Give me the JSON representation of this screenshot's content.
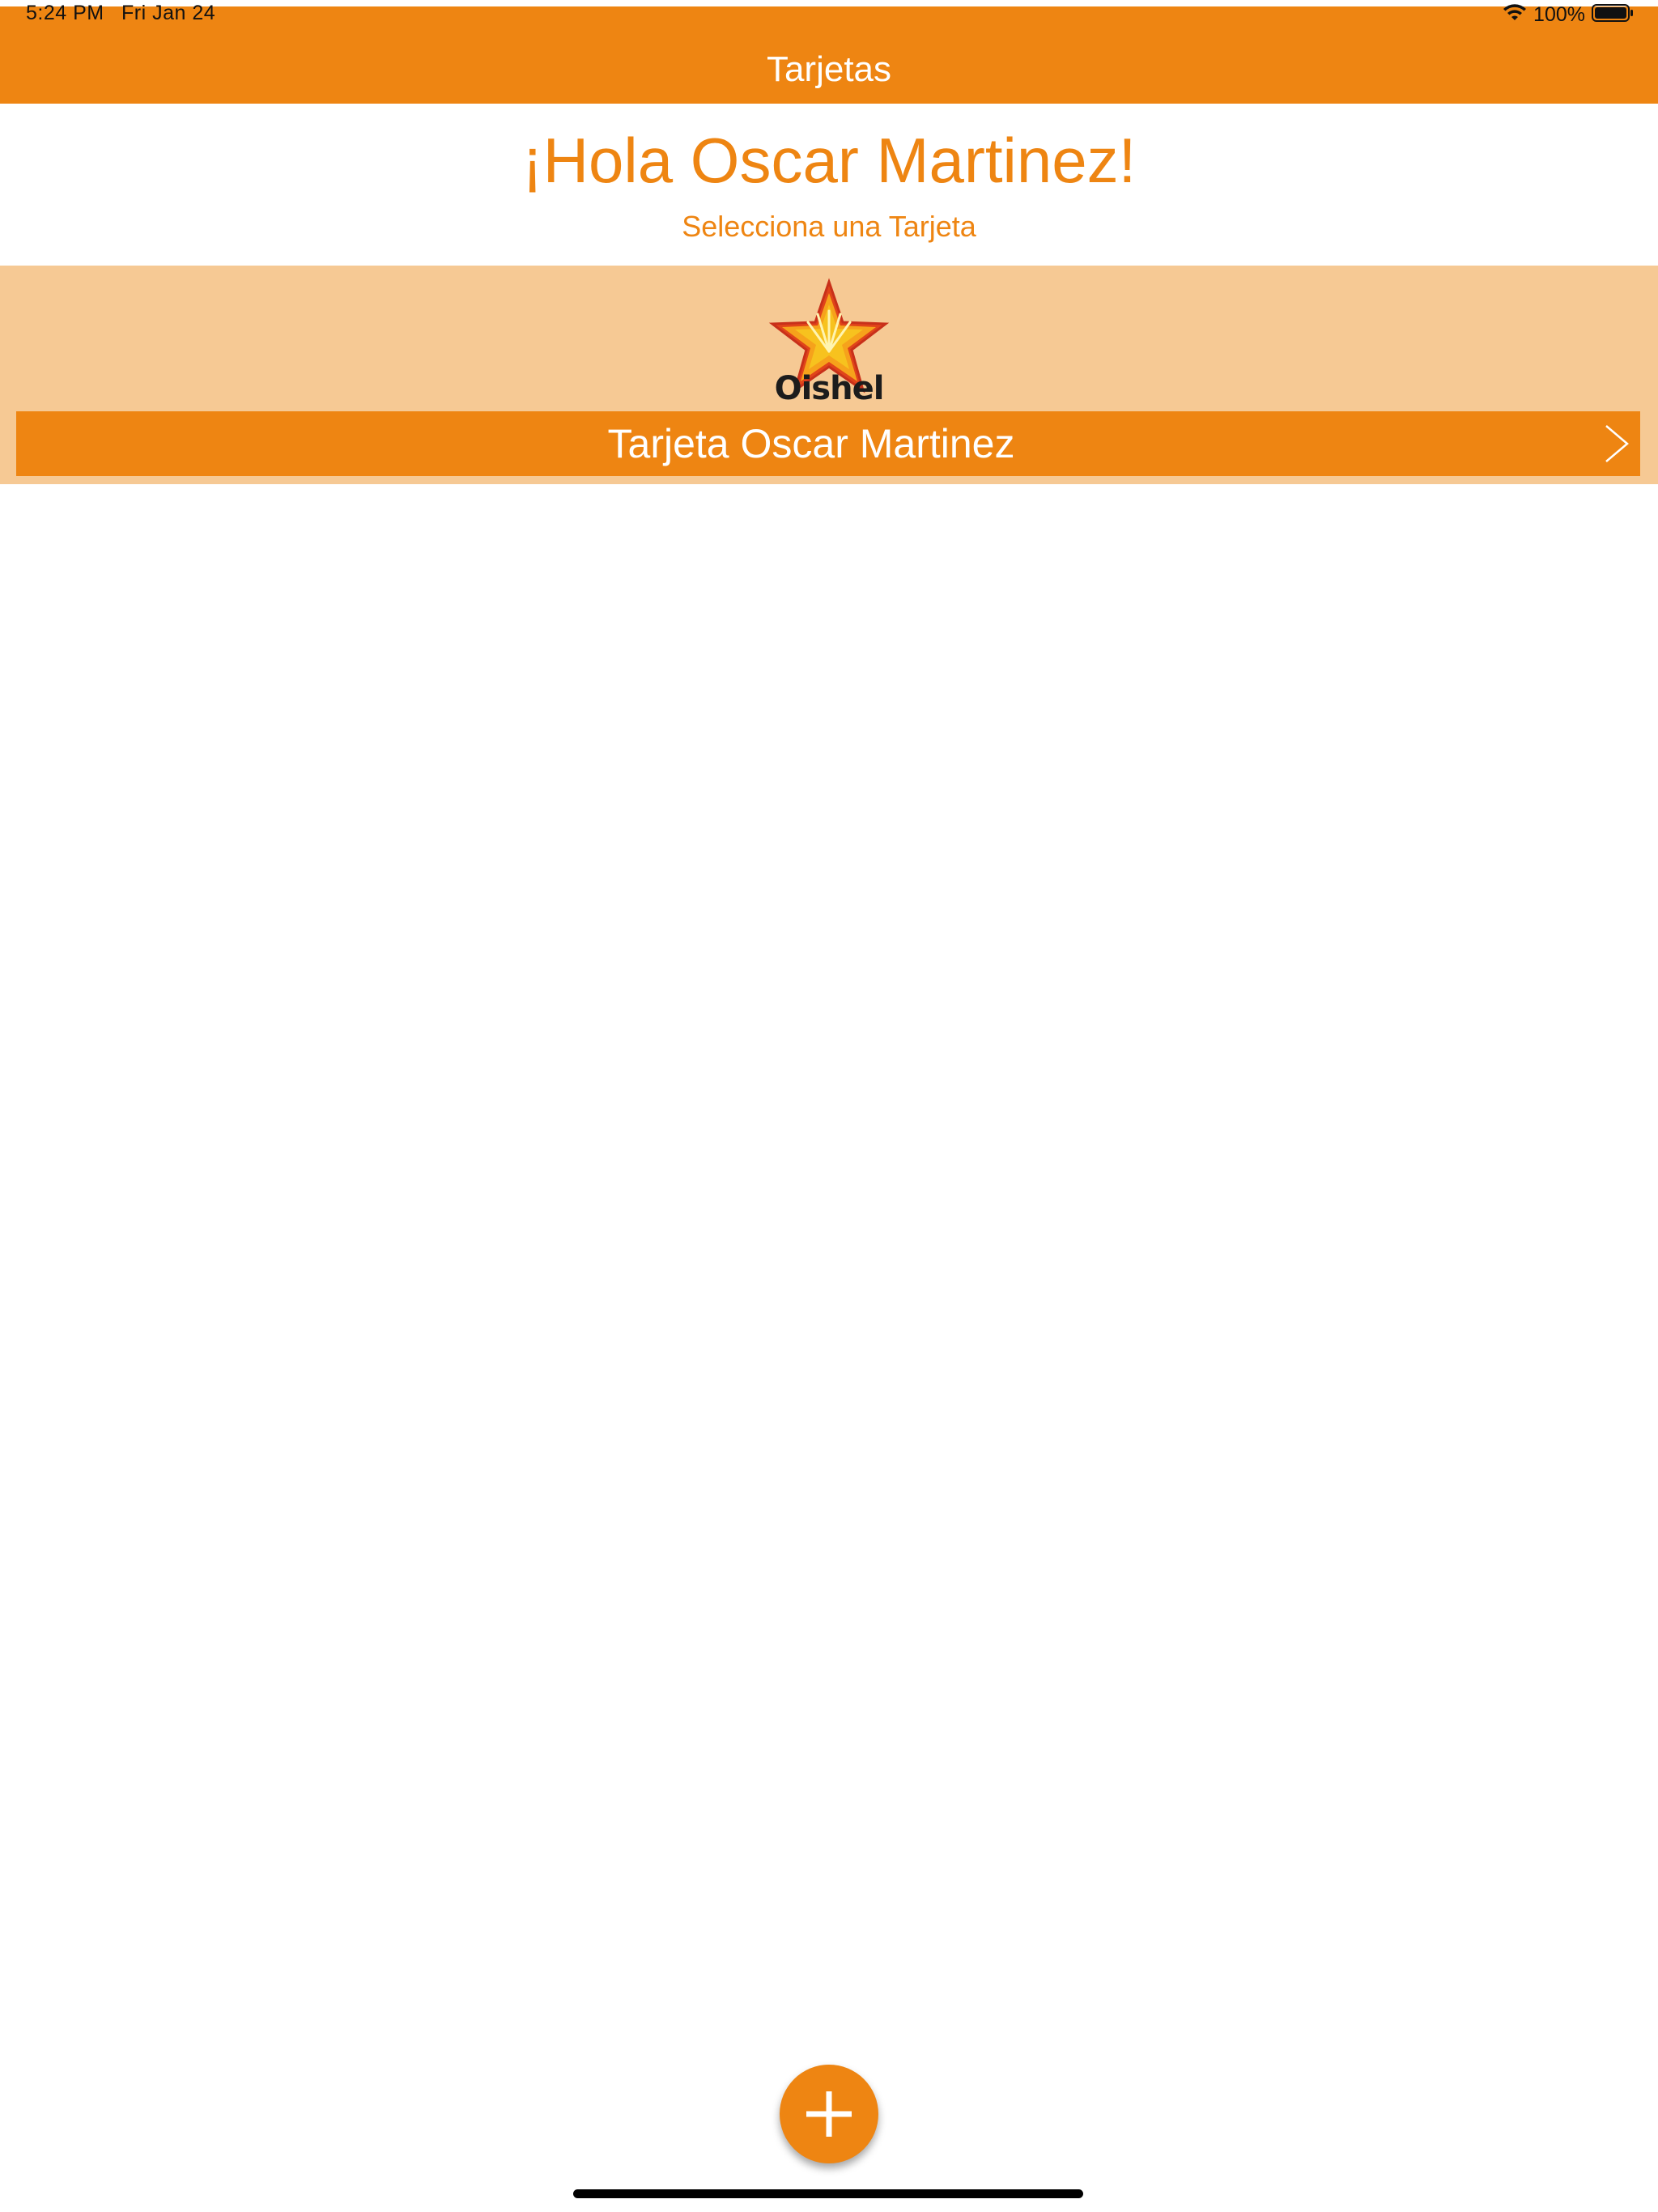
{
  "status_bar": {
    "time": "5:24 PM",
    "date": "Fri Jan 24",
    "battery": "100%",
    "icons": [
      "wifi-icon",
      "battery-icon"
    ]
  },
  "nav": {
    "title": "Tarjetas"
  },
  "main": {
    "greeting": "¡Hola Oscar Martinez!",
    "subtitle": "Selecciona una Tarjeta"
  },
  "cards": [
    {
      "brand": "Oishel",
      "label": "Tarjeta Oscar Martinez",
      "icon": "chevron-right-icon"
    }
  ],
  "actions": {
    "add_icon": "plus-icon"
  },
  "colors": {
    "accent": "#ee8512",
    "card_background": "#f6c994",
    "background": "#ffffff"
  }
}
